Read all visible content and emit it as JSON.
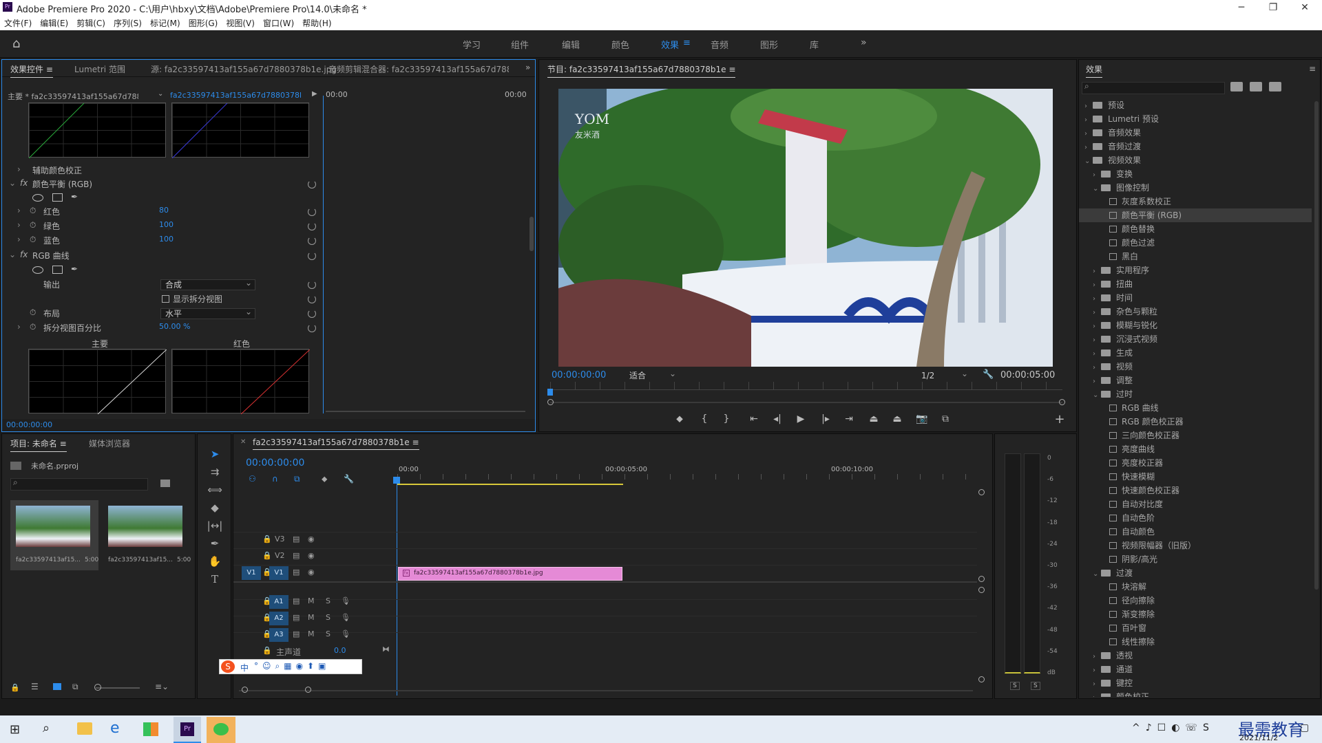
{
  "window": {
    "title": "Adobe Premiere Pro 2020 - C:\\用户\\hbxy\\文档\\Adobe\\Premiere Pro\\14.0\\未命名 *"
  },
  "menu": [
    "文件(F)",
    "编辑(E)",
    "剪辑(C)",
    "序列(S)",
    "标记(M)",
    "图形(G)",
    "视图(V)",
    "窗口(W)",
    "帮助(H)"
  ],
  "workspaces": [
    "学习",
    "组件",
    "编辑",
    "颜色",
    "效果",
    "音频",
    "图形",
    "库"
  ],
  "active_workspace": "效果",
  "effect_controls": {
    "tabs": [
      "效果控件",
      "Lumetri 范围",
      "源: fa2c33597413af155a67d7880378b1e.jpg",
      "音频剪辑混合器: fa2c33597413af155a67d7880378"
    ],
    "master": "主要 * fa2c33597413af155a67d788037...",
    "clip": "fa2c33597413af155a67d7880378b1e ...",
    "time_start": "00:00",
    "time_end": "00:00",
    "aux": "辅助颜色校正",
    "color_balance": "颜色平衡 (RGB)",
    "red_label": "红色",
    "red": "80",
    "green_label": "绿色",
    "green": "100",
    "blue_label": "蓝色",
    "blue": "100",
    "rgb_curves": "RGB 曲线",
    "output_label": "输出",
    "output": "合成",
    "show_split": "显示拆分视图",
    "layout_label": "布局",
    "layout": "水平",
    "split_label": "拆分视图百分比",
    "split": "50.00 %",
    "graph1": "主要",
    "graph2": "红色",
    "timecode": "00:00:00:00"
  },
  "program": {
    "title": "节目: fa2c33597413af155a67d7880378b1e",
    "timecode": "00:00:00:00",
    "fit": "适合",
    "scale": "1/2",
    "duration": "00:00:05:00",
    "sign1": "YOM",
    "sign2": "友米酒"
  },
  "effects": {
    "title": "效果",
    "items": [
      {
        "t": "预设",
        "lvl": 0,
        "type": "folder",
        "open": false
      },
      {
        "t": "Lumetri 预设",
        "lvl": 0,
        "type": "folder",
        "open": false
      },
      {
        "t": "音频效果",
        "lvl": 0,
        "type": "folder",
        "open": false
      },
      {
        "t": "音频过渡",
        "lvl": 0,
        "type": "folder",
        "open": false
      },
      {
        "t": "视频效果",
        "lvl": 0,
        "type": "folder",
        "open": true
      },
      {
        "t": "变换",
        "lvl": 1,
        "type": "folder",
        "open": false
      },
      {
        "t": "图像控制",
        "lvl": 1,
        "type": "folder",
        "open": true
      },
      {
        "t": "灰度系数校正",
        "lvl": 2,
        "type": "fx"
      },
      {
        "t": "颜色平衡 (RGB)",
        "lvl": 2,
        "type": "fx",
        "sel": true
      },
      {
        "t": "颜色替换",
        "lvl": 2,
        "type": "fx"
      },
      {
        "t": "颜色过滤",
        "lvl": 2,
        "type": "fx"
      },
      {
        "t": "黑白",
        "lvl": 2,
        "type": "fx"
      },
      {
        "t": "实用程序",
        "lvl": 1,
        "type": "folder",
        "open": false
      },
      {
        "t": "扭曲",
        "lvl": 1,
        "type": "folder",
        "open": false
      },
      {
        "t": "时间",
        "lvl": 1,
        "type": "folder",
        "open": false
      },
      {
        "t": "杂色与颗粒",
        "lvl": 1,
        "type": "folder",
        "open": false
      },
      {
        "t": "模糊与锐化",
        "lvl": 1,
        "type": "folder",
        "open": false
      },
      {
        "t": "沉浸式视频",
        "lvl": 1,
        "type": "folder",
        "open": false
      },
      {
        "t": "生成",
        "lvl": 1,
        "type": "folder",
        "open": false
      },
      {
        "t": "视频",
        "lvl": 1,
        "type": "folder",
        "open": false
      },
      {
        "t": "调整",
        "lvl": 1,
        "type": "folder",
        "open": false
      },
      {
        "t": "过时",
        "lvl": 1,
        "type": "folder",
        "open": true
      },
      {
        "t": "RGB 曲线",
        "lvl": 2,
        "type": "fx"
      },
      {
        "t": "RGB 颜色校正器",
        "lvl": 2,
        "type": "fx"
      },
      {
        "t": "三向颜色校正器",
        "lvl": 2,
        "type": "fx"
      },
      {
        "t": "亮度曲线",
        "lvl": 2,
        "type": "fx"
      },
      {
        "t": "亮度校正器",
        "lvl": 2,
        "type": "fx"
      },
      {
        "t": "快速模糊",
        "lvl": 2,
        "type": "fx"
      },
      {
        "t": "快速颜色校正器",
        "lvl": 2,
        "type": "fx"
      },
      {
        "t": "自动对比度",
        "lvl": 2,
        "type": "fx"
      },
      {
        "t": "自动色阶",
        "lvl": 2,
        "type": "fx"
      },
      {
        "t": "自动颜色",
        "lvl": 2,
        "type": "fx"
      },
      {
        "t": "视频限幅器（旧版）",
        "lvl": 2,
        "type": "fx"
      },
      {
        "t": "阴影/高光",
        "lvl": 2,
        "type": "fx"
      },
      {
        "t": "过渡",
        "lvl": 1,
        "type": "folder",
        "open": true
      },
      {
        "t": "块溶解",
        "lvl": 2,
        "type": "fx"
      },
      {
        "t": "径向擦除",
        "lvl": 2,
        "type": "fx"
      },
      {
        "t": "渐变擦除",
        "lvl": 2,
        "type": "fx"
      },
      {
        "t": "百叶窗",
        "lvl": 2,
        "type": "fx"
      },
      {
        "t": "线性擦除",
        "lvl": 2,
        "type": "fx"
      },
      {
        "t": "透视",
        "lvl": 1,
        "type": "folder",
        "open": false
      },
      {
        "t": "通道",
        "lvl": 1,
        "type": "folder",
        "open": false
      },
      {
        "t": "键控",
        "lvl": 1,
        "type": "folder",
        "open": false
      },
      {
        "t": "颜色校正",
        "lvl": 1,
        "type": "folder",
        "open": false
      }
    ]
  },
  "project": {
    "tabs": [
      "项目: 未命名",
      "媒体浏览器"
    ],
    "file": "未命名.prproj",
    "thumbs": [
      {
        "name": "fa2c33597413af15...",
        "dur": "5:00"
      },
      {
        "name": "fa2c33597413af15...",
        "dur": "5:00"
      }
    ]
  },
  "timeline": {
    "tab": "fa2c33597413af155a67d7880378b1e",
    "timecode": "00:00:00:00",
    "ruler": [
      "00:00",
      "00:00:05:00",
      "00:00:10:00"
    ],
    "video_tracks": [
      "V3",
      "V2",
      "V1"
    ],
    "audio_tracks": [
      "A1",
      "A2",
      "A3"
    ],
    "source_v": "V1",
    "master": "主声道",
    "master_val": "0.0",
    "clip": "fa2c33597413af155a67d7880378b1e.jpg",
    "m": "M",
    "s": "S"
  },
  "meter": {
    "scale": [
      "0",
      "-6",
      "-12",
      "-18",
      "-24",
      "-30",
      "-36",
      "-42",
      "-48",
      "-54",
      "dB"
    ],
    "s1": "S",
    "s2": "S"
  },
  "ime": {
    "label": "中"
  },
  "taskbar": {
    "watermark": "最需教育",
    "date": "2021/11/2"
  },
  "colors": {
    "accent": "#2d8ceb",
    "clip": "#e58ad6",
    "selection": "#3b3b3b"
  }
}
